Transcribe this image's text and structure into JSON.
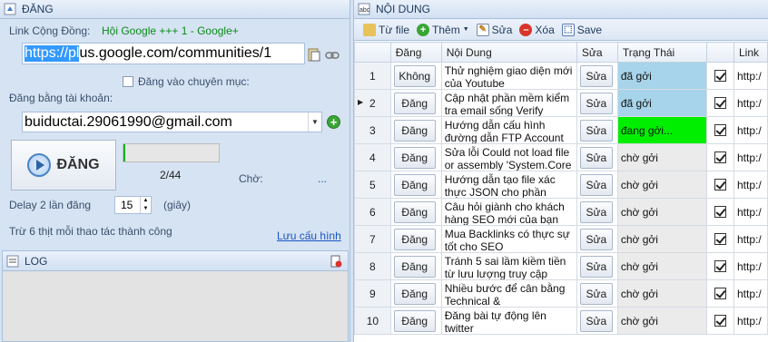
{
  "left": {
    "header_title": "ĐĂNG",
    "community_label": "Link Cộng Đồng:",
    "community_name": "Hội Google +++ 1 - Google+",
    "community_url_selected": "https://pl",
    "community_url_rest": "us.google.com/communities/1",
    "category_checkbox_label": "Đăng vào chuyên mục:",
    "account_label": "Đăng bằng tài khoản:",
    "account_value": "buiductai.29061990@gmail.com",
    "post_button": "ĐĂNG",
    "progress_percent": 2,
    "progress_text": "2/44",
    "wait_label": "Chờ:",
    "wait_value": "...",
    "delay_label": "Delay 2 lần đăng",
    "delay_value": "15",
    "delay_unit": "(giây)",
    "cost_text": "Trừ 6 thịt mỗi thao tác thành công",
    "save_config": "Lưu cấu hình",
    "log_title": "LOG"
  },
  "right": {
    "header_title": "NỘI DUNG",
    "toolbar": {
      "from_file": "Từ file",
      "add": "Thêm",
      "edit": "Sửa",
      "delete": "Xóa",
      "save": "Save"
    },
    "columns": [
      "Đăng",
      "Nội Dung",
      "Sửa",
      "Trạng Thái",
      "",
      "Link"
    ],
    "rows": [
      {
        "num": "1",
        "post": "Không",
        "content": "Thử nghiệm giao diện mới của Youtube",
        "edit": "Sửa",
        "status": "đã gởi",
        "status_type": "sent",
        "link": "http:/"
      },
      {
        "num": "2",
        "post": "Đăng",
        "content": "Cập nhật phần mềm kiểm tra email sống Verify",
        "edit": "Sửa",
        "status": "đã gởi",
        "status_type": "sent",
        "link": "http:/"
      },
      {
        "num": "3",
        "post": "Đăng",
        "content": "Hướng dẫn cấu hình đường dẫn FTP Account",
        "edit": "Sửa",
        "status": "đang gởi...",
        "status_type": "sending",
        "link": "http:/"
      },
      {
        "num": "4",
        "post": "Đăng",
        "content": "Sửa lỗi Could not load file or assembly 'System.Core",
        "edit": "Sửa",
        "status": "chờ gởi",
        "status_type": "wait",
        "link": "http:/"
      },
      {
        "num": "5",
        "post": "Đăng",
        "content": "Hướng dẫn tạo file xác thực JSON cho phần",
        "edit": "Sửa",
        "status": "chờ gởi",
        "status_type": "wait",
        "link": "http:/"
      },
      {
        "num": "6",
        "post": "Đăng",
        "content": "Câu hỏi giành cho khách hàng SEO mới của bạn",
        "edit": "Sửa",
        "status": "chờ gởi",
        "status_type": "wait",
        "link": "http:/"
      },
      {
        "num": "7",
        "post": "Đăng",
        "content": "Mua Backlinks có thực sự tốt cho SEO",
        "edit": "Sửa",
        "status": "chờ gởi",
        "status_type": "wait",
        "link": "http:/"
      },
      {
        "num": "8",
        "post": "Đăng",
        "content": "Tránh 5 sai lầm kiềm tiền từ lưu lượng truy cập",
        "edit": "Sửa",
        "status": "chờ gởi",
        "status_type": "wait",
        "link": "http:/"
      },
      {
        "num": "9",
        "post": "Đăng",
        "content": "Nhiều bước để cân bằng Technical &",
        "edit": "Sửa",
        "status": "chờ gởi",
        "status_type": "wait",
        "link": "http:/"
      },
      {
        "num": "10",
        "post": "Đăng",
        "content": "Đăng bài tự động lên twitter",
        "edit": "Sửa",
        "status": "chờ gởi",
        "status_type": "wait",
        "link": "http:/"
      }
    ],
    "current_row": "2"
  },
  "colors": {
    "sent": "#a7d4ea",
    "sending": "#00ef00",
    "wait": "#ebebeb",
    "progress": "#06b025"
  }
}
